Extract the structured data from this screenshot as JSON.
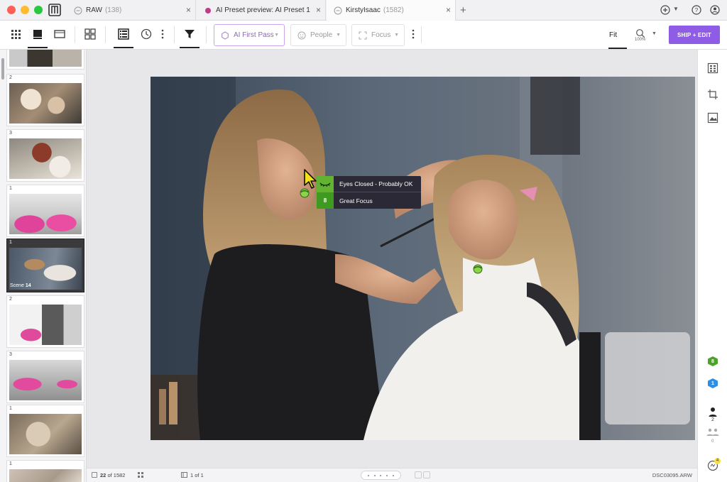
{
  "tabs": [
    {
      "label": "RAW",
      "count": "(138)"
    },
    {
      "label": "AI Preset preview: AI Preset 1",
      "count": ""
    },
    {
      "label": "KirstyIsaac",
      "count": "(1582)"
    }
  ],
  "titlebar": {
    "new_tab": "+"
  },
  "toolbar": {
    "filters": [
      {
        "label": "AI First Pass"
      },
      {
        "label": "People"
      },
      {
        "label": "Focus"
      }
    ],
    "fit_label": "Fit",
    "zoom_value": "100%",
    "ship_label": "SHIP + EDIT"
  },
  "filmstrip": {
    "thumbs": [
      {
        "num": "",
        "selected": false
      },
      {
        "num": "2",
        "selected": false
      },
      {
        "num": "3",
        "selected": false
      },
      {
        "num": "1",
        "selected": false
      },
      {
        "num": "1",
        "selected": true,
        "scene_label": "Scene",
        "scene_num": "14"
      },
      {
        "num": "2",
        "selected": false
      },
      {
        "num": "3",
        "selected": false
      },
      {
        "num": "1",
        "selected": false
      },
      {
        "num": "1",
        "selected": false
      }
    ],
    "scene_popout_num": "1"
  },
  "overlay": {
    "eyes_label": "Eyes Closed - Probably OK",
    "focus_score": "8",
    "focus_label": "Great Focus"
  },
  "rightrail": {
    "green_count": "8",
    "blue_count": "1",
    "person_count": "2",
    "group_count": "0",
    "notice_count": "4"
  },
  "statusbar": {
    "current": "22",
    "of_total": "of 1582",
    "pages": "1 of 1",
    "filename": "DSC03095.ARW"
  },
  "colors": {
    "accent": "#8f5ce6",
    "ai_pill_border": "#c9a6e8",
    "eyes_green": "#63b332",
    "focus_green": "#3f9a20",
    "badge_bg": "#2b2935",
    "scene_blue": "#3d93e8"
  }
}
